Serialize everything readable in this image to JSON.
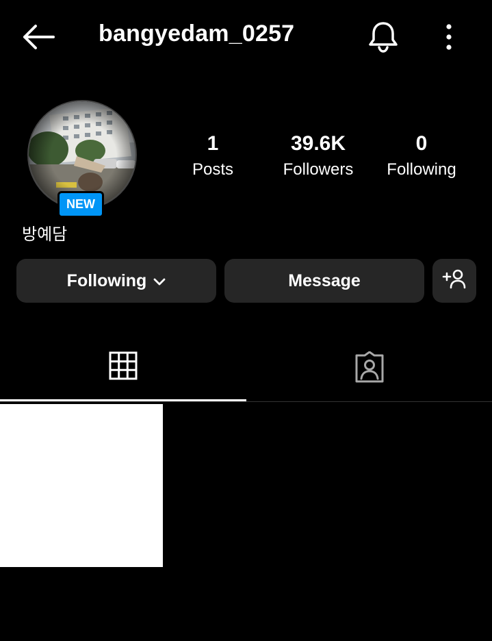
{
  "header": {
    "username": "bangyedam_0257",
    "back_icon": "arrow-left-icon",
    "bell_icon": "bell-icon",
    "more_icon": "more-vertical-icon"
  },
  "profile": {
    "badge": "NEW",
    "display_name": "방예담",
    "avatar_icon": "profile-photo"
  },
  "stats": {
    "posts": {
      "value": "1",
      "label": "Posts"
    },
    "followers": {
      "value": "39.6K",
      "label": "Followers"
    },
    "following": {
      "value": "0",
      "label": "Following"
    }
  },
  "actions": {
    "following_label": "Following",
    "message_label": "Message",
    "add_icon": "add-person-icon"
  },
  "tabs": [
    {
      "icon": "grid-icon",
      "active": true
    },
    {
      "icon": "tagged-icon",
      "active": false
    }
  ],
  "colors": {
    "background": "#000000",
    "button": "#262626",
    "badge": "#0095f6"
  }
}
